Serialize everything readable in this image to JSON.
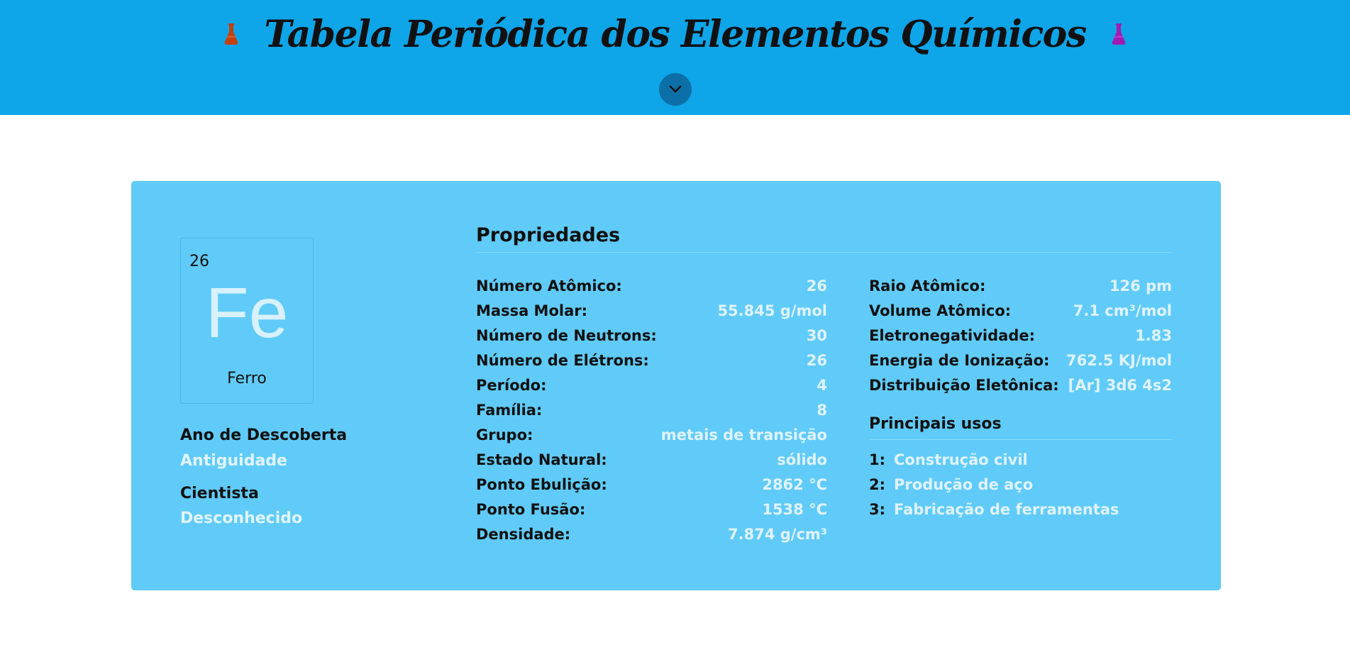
{
  "header": {
    "title": "Tabela Periódica dos Elementos Químicos",
    "flask_left_icon": "flask-icon",
    "flask_left_color": "#c2410c",
    "flask_right_icon": "flask-icon",
    "flask_right_color": "#a21caf",
    "toggle_icon": "chevron-down-icon",
    "background": "#0ea5e9"
  },
  "element": {
    "number": "26",
    "symbol": "Fe",
    "name": "Ferro"
  },
  "discovery": {
    "year_label": "Ano de Descoberta",
    "year_value": "Antiguidade",
    "scientist_label": "Cientista",
    "scientist_value": "Desconhecido"
  },
  "properties": {
    "title": "Propriedades",
    "left": [
      {
        "label": "Número Atômico:",
        "value": "26"
      },
      {
        "label": "Massa Molar:",
        "value": "55.845 g/mol"
      },
      {
        "label": "Número de Neutrons:",
        "value": "30"
      },
      {
        "label": "Número de Elétrons:",
        "value": "26"
      },
      {
        "label": "Período:",
        "value": "4"
      },
      {
        "label": "Família:",
        "value": "8"
      },
      {
        "label": "Grupo:",
        "value": "metais de transição"
      },
      {
        "label": "Estado Natural:",
        "value": "sólido"
      },
      {
        "label": "Ponto Ebulição:",
        "value": "2862 °C"
      },
      {
        "label": "Ponto Fusão:",
        "value": "1538 °C"
      },
      {
        "label": "Densidade:",
        "value": "7.874 g/cm³"
      }
    ],
    "right": [
      {
        "label": "Raio Atômico:",
        "value": "126 pm"
      },
      {
        "label": "Volume Atômico:",
        "value": "7.1 cm³/mol"
      },
      {
        "label": "Eletronegatividade:",
        "value": "1.83"
      },
      {
        "label": "Energia de Ionização:",
        "value": "762.5 KJ/mol"
      },
      {
        "label": "Distribuição Eletônica:",
        "value": "[Ar] 3d6 4s2"
      }
    ]
  },
  "uses": {
    "title": "Principais usos",
    "items": [
      {
        "num": "1:",
        "text": "Construção civil"
      },
      {
        "num": "2:",
        "text": "Produção de aço"
      },
      {
        "num": "3:",
        "text": "Fabricação de ferramentas"
      }
    ]
  }
}
